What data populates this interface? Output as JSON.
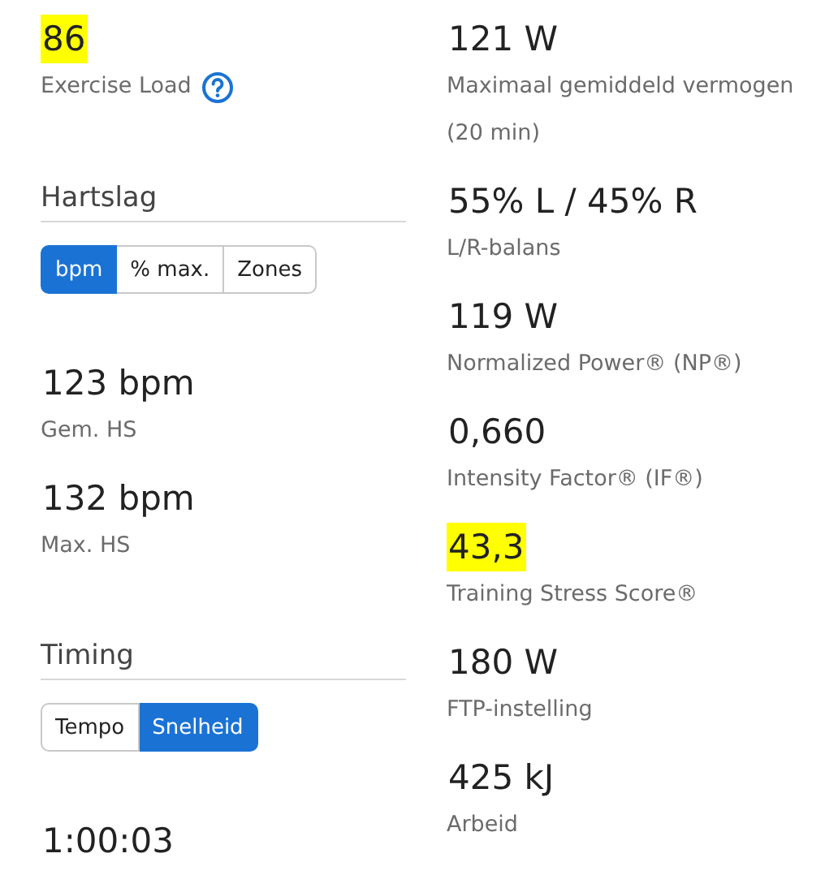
{
  "exercise_load": {
    "value": "86",
    "label": "Exercise Load",
    "highlighted": true
  },
  "sections": [
    {
      "title": "Hartslag",
      "toggle": [
        {
          "label": "bpm",
          "selected": true
        },
        {
          "label": "% max.",
          "selected": false
        },
        {
          "label": "Zones",
          "selected": false
        }
      ],
      "stats": [
        {
          "value": "123 bpm",
          "label": "Gem. HS",
          "highlighted": false
        },
        {
          "value": "132 bpm",
          "label": "Max. HS",
          "highlighted": false
        }
      ]
    },
    {
      "title": "Timing",
      "toggle": [
        {
          "label": "Tempo",
          "selected": false
        },
        {
          "label": "Snelheid",
          "selected": true
        }
      ],
      "stats": [
        {
          "value": "1:00:03",
          "highlighted": false
        }
      ]
    }
  ],
  "power_stats": [
    {
      "value": "121 W",
      "label": "Maximaal gemiddeld vermogen",
      "sublabel": "(20 min)",
      "highlighted": false
    },
    {
      "value": "55% L / 45% R",
      "label": "L/R-balans",
      "highlighted": false
    },
    {
      "value": "119 W",
      "label": "Normalized Power® (NP®)",
      "highlighted": false
    },
    {
      "value": "0,660",
      "label": "Intensity Factor® (IF®)",
      "highlighted": false
    },
    {
      "value": "43,3",
      "label": "Training Stress Score®",
      "highlighted": true
    },
    {
      "value": "180 W",
      "label": "FTP-instelling",
      "highlighted": false
    },
    {
      "value": "425 kJ",
      "label": "Arbeid",
      "highlighted": false
    }
  ]
}
